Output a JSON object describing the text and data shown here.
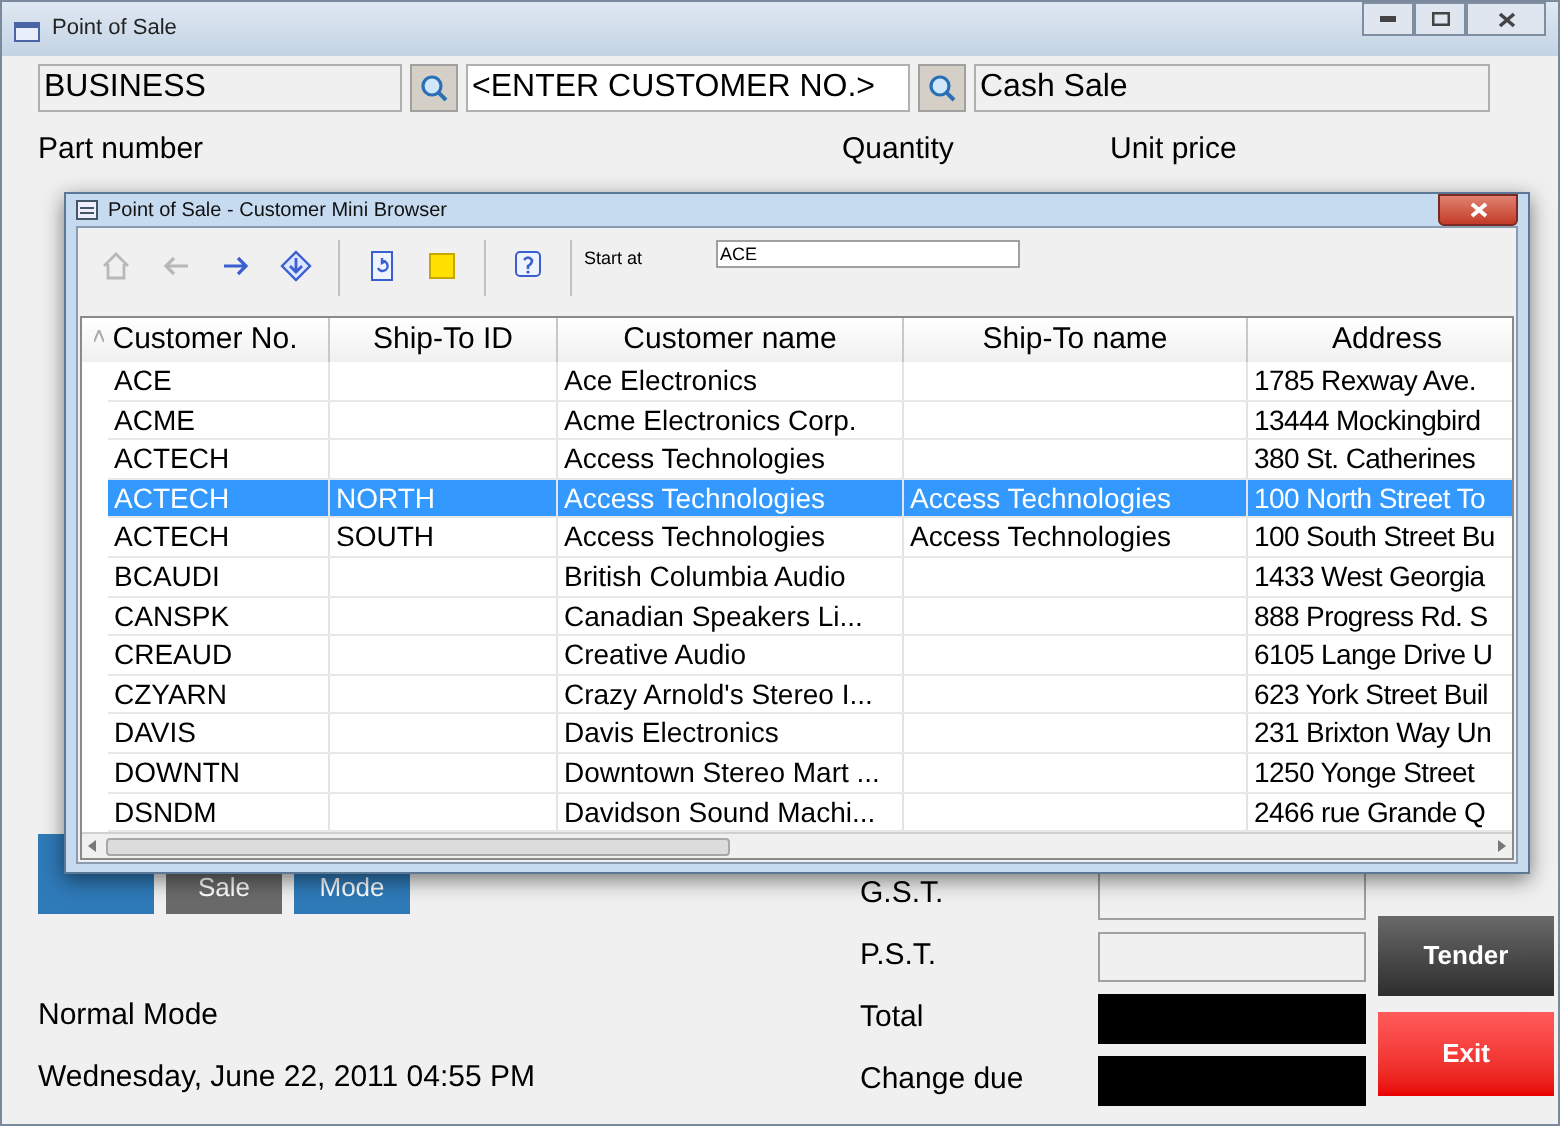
{
  "window": {
    "title": "Point of Sale"
  },
  "customer_bar": {
    "type": "BUSINESS",
    "customer_no": {
      "placeholder": "<ENTER CUSTOMER NO.>"
    },
    "customer_name": "Cash Sale"
  },
  "entry_labels": [
    "Part number",
    "Quantity",
    "Unit price"
  ],
  "mode_buttons": [
    {
      "kind": "accent"
    },
    {
      "kind": "plain",
      "label": "Sale"
    },
    {
      "kind": "accent",
      "label": "Mode"
    }
  ],
  "totals": [
    {
      "label": "G.S.T.",
      "kind": "field"
    },
    {
      "label": "P.S.T.",
      "kind": "field"
    },
    {
      "label": "Total",
      "kind": "display"
    },
    {
      "label": "Change due",
      "kind": "display"
    }
  ],
  "status": {
    "mode": "Normal Mode",
    "datetime": "Wednesday, June 22, 2011 04:55 PM"
  },
  "actions": [
    {
      "label": "Tender",
      "kind": "neutral"
    },
    {
      "label": "Exit",
      "kind": "danger"
    }
  ],
  "browser": {
    "title": "Point of Sale - Customer Mini Browser",
    "toolbar": [
      {
        "kind": "home",
        "disabled": true
      },
      {
        "kind": "back",
        "disabled": true
      },
      {
        "kind": "forward",
        "disabled": false
      },
      {
        "kind": "jump",
        "disabled": false
      },
      {
        "kind": "sep"
      },
      {
        "kind": "refresh",
        "disabled": false
      },
      {
        "kind": "note",
        "disabled": false
      },
      {
        "kind": "sep"
      },
      {
        "kind": "help",
        "disabled": false
      },
      {
        "kind": "sep"
      }
    ],
    "start_at": {
      "label": "Start at",
      "value": "ACE"
    },
    "columns": [
      {
        "label": "Customer No.",
        "sorted": true
      },
      {
        "label": "Ship-To ID",
        "sorted": false
      },
      {
        "label": "Customer name",
        "sorted": false
      },
      {
        "label": "Ship-To name",
        "sorted": false
      },
      {
        "label": "Address",
        "sorted": false
      }
    ],
    "rows": [
      {
        "cells": [
          "ACE",
          "",
          "Ace Electronics",
          "",
          "1785 Rexway Ave."
        ],
        "selected": false
      },
      {
        "cells": [
          "ACME",
          "",
          "Acme Electronics Corp.",
          "",
          "13444 Mockingbird"
        ],
        "selected": false
      },
      {
        "cells": [
          "ACTECH",
          "",
          "Access Technologies",
          "",
          "380 St. Catherines"
        ],
        "selected": false
      },
      {
        "cells": [
          "ACTECH",
          "NORTH",
          "Access Technologies",
          "Access Technologies",
          "100 North Street To"
        ],
        "selected": true
      },
      {
        "cells": [
          "ACTECH",
          "SOUTH",
          "Access Technologies",
          "Access Technologies",
          "100 South Street Bu"
        ],
        "selected": false
      },
      {
        "cells": [
          "BCAUDI",
          "",
          "British Columbia Audio",
          "",
          "1433 West Georgia"
        ],
        "selected": false
      },
      {
        "cells": [
          "CANSPK",
          "",
          "Canadian Speakers Li...",
          "",
          "888 Progress Rd. S"
        ],
        "selected": false
      },
      {
        "cells": [
          "CREAUD",
          "",
          "Creative Audio",
          "",
          "6105 Lange Drive U"
        ],
        "selected": false
      },
      {
        "cells": [
          "CZYARN",
          "",
          "Crazy Arnold's Stereo I...",
          "",
          "623 York Street Buil"
        ],
        "selected": false
      },
      {
        "cells": [
          "DAVIS",
          "",
          "Davis Electronics",
          "",
          "231 Brixton Way Un"
        ],
        "selected": false
      },
      {
        "cells": [
          "DOWNTN",
          "",
          "Downtown Stereo Mart ...",
          "",
          "1250 Yonge Street"
        ],
        "selected": false
      },
      {
        "cells": [
          "DSNDM",
          "",
          "Davidson Sound Machi...",
          "",
          "2466 rue Grande Q"
        ],
        "selected": false
      }
    ]
  }
}
